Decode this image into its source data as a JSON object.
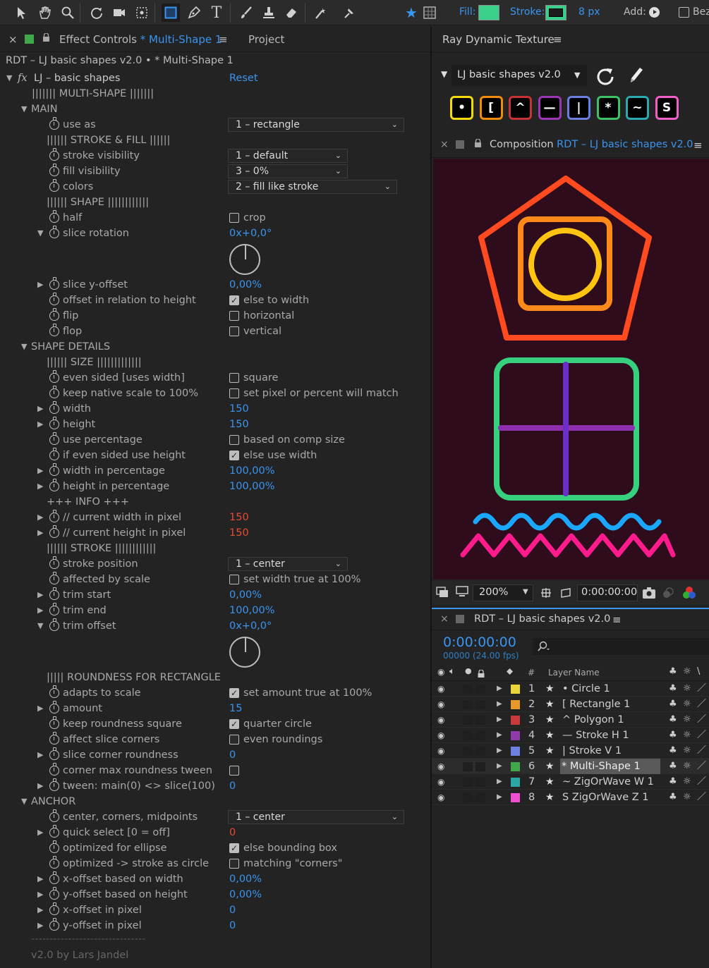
{
  "toolbar": {
    "fill_label": "Fill:",
    "fill_color": "#3ad08c",
    "stroke_label": "Stroke:",
    "stroke_color": "#3ad08c",
    "stroke_width": "8 px",
    "add_label": "Add:",
    "bez_label": "Bez"
  },
  "effect_panel": {
    "close": "×",
    "tab_prefix": "Effect Controls",
    "tab_layer": "* Multi-Shape 1",
    "menu": "≡",
    "tab_project": "Project",
    "breadcrumb": "RDT – LJ basic shapes v2.0 • * Multi-Shape 1",
    "fx": "fx",
    "effect_name": "LJ – basic shapes",
    "reset": "Reset",
    "footer_line": "-------------------------------",
    "footer": "v2.0 by Lars Jandel"
  },
  "rows": [
    {
      "ind": 45,
      "txt": "||||||| MULTI-SHAPE |||||||"
    },
    {
      "ind": 30,
      "tw": "▼",
      "txt": "MAIN"
    },
    {
      "ind": 70,
      "sw": 1,
      "txt": "use as",
      "dd": "1 – rectangle",
      "ddw": 250
    },
    {
      "ind": 66,
      "txt": "|||||| STROKE & FILL ||||||"
    },
    {
      "ind": 70,
      "sw": 1,
      "txt": "stroke visibility",
      "dd": "1 – default",
      "ddw": 170
    },
    {
      "ind": 70,
      "sw": 1,
      "txt": "fill visibility",
      "dd": "3 – 0%",
      "ddw": 170
    },
    {
      "ind": 70,
      "sw": 1,
      "txt": "colors",
      "dd": "2 – fill like stroke",
      "ddw": 240
    },
    {
      "ind": 66,
      "txt": "|||||| SHAPE ||||||||||||"
    },
    {
      "ind": 70,
      "sw": 1,
      "txt": "half",
      "cb": 0,
      "cbl": "crop"
    },
    {
      "ind": 70,
      "sw": 1,
      "tw": "▼",
      "txt": "slice rotation",
      "num": "0x+0,0°",
      "dial": 1
    },
    {
      "ind": 70,
      "sw": 1,
      "tw": "▶",
      "txt": "slice y-offset",
      "num": "0,00%"
    },
    {
      "ind": 70,
      "sw": 1,
      "txt": "offset in relation to height",
      "cb": 1,
      "cbl": "else to width"
    },
    {
      "ind": 70,
      "sw": 1,
      "txt": "flip",
      "cb": 0,
      "cbl": "horizontal"
    },
    {
      "ind": 70,
      "sw": 1,
      "txt": "flop",
      "cb": 0,
      "cbl": "vertical"
    },
    {
      "ind": 30,
      "tw": "▼",
      "txt": "SHAPE DETAILS"
    },
    {
      "ind": 66,
      "txt": "|||||| SIZE |||||||||||||"
    },
    {
      "ind": 70,
      "sw": 1,
      "txt": "even sided [uses width]",
      "cb": 0,
      "cbl": "square"
    },
    {
      "ind": 70,
      "sw": 1,
      "txt": "keep native scale to 100%",
      "cb": 0,
      "cbl": "set pixel or percent will match"
    },
    {
      "ind": 70,
      "sw": 1,
      "tw": "▶",
      "txt": "width",
      "num": "150"
    },
    {
      "ind": 70,
      "sw": 1,
      "tw": "▶",
      "txt": "height",
      "num": "150"
    },
    {
      "ind": 70,
      "sw": 1,
      "txt": "use percentage",
      "cb": 0,
      "cbl": "based on comp size"
    },
    {
      "ind": 70,
      "sw": 1,
      "txt": "if even sided use height",
      "cb": 1,
      "cbl": "else use width"
    },
    {
      "ind": 70,
      "sw": 1,
      "tw": "▶",
      "txt": "width in percentage",
      "num": "100,00%"
    },
    {
      "ind": 70,
      "sw": 1,
      "tw": "▶",
      "txt": "height in percentage",
      "num": "100,00%"
    },
    {
      "ind": 66,
      "txt": "+++ INFO +++"
    },
    {
      "ind": 70,
      "sw": 1,
      "tw": "▶",
      "txt": "// current width in pixel",
      "red": "150"
    },
    {
      "ind": 70,
      "sw": 1,
      "tw": "▶",
      "txt": "// current height in pixel",
      "red": "150"
    },
    {
      "ind": 66,
      "txt": "|||||| STROKE ||||||||||||"
    },
    {
      "ind": 70,
      "sw": 1,
      "txt": "stroke position",
      "dd": "1 – center",
      "ddw": 170
    },
    {
      "ind": 70,
      "sw": 1,
      "txt": "affected by scale",
      "cb": 0,
      "cbl": "set width true at 100%"
    },
    {
      "ind": 70,
      "sw": 1,
      "tw": "▶",
      "txt": "trim start",
      "num": "0,00%"
    },
    {
      "ind": 70,
      "sw": 1,
      "tw": "▶",
      "txt": "trim end",
      "num": "100,00%"
    },
    {
      "ind": 70,
      "sw": 1,
      "tw": "▼",
      "txt": "trim offset",
      "num": "0x+0,0°",
      "dial": 1
    },
    {
      "ind": 66,
      "txt": "||||| ROUNDNESS FOR RECTANGLE"
    },
    {
      "ind": 70,
      "sw": 1,
      "txt": "adapts to scale",
      "cb": 1,
      "cbl": "set amount true at 100%"
    },
    {
      "ind": 70,
      "sw": 1,
      "tw": "▶",
      "txt": "amount",
      "num": "15"
    },
    {
      "ind": 70,
      "sw": 1,
      "txt": "keep roundness square",
      "cb": 1,
      "cbl": "quarter circle"
    },
    {
      "ind": 70,
      "sw": 1,
      "txt": "affect slice corners",
      "cb": 0,
      "cbl": "even roundings"
    },
    {
      "ind": 70,
      "sw": 1,
      "tw": "▶",
      "txt": "slice corner roundness",
      "num": "0"
    },
    {
      "ind": 70,
      "sw": 1,
      "txt": "corner max roundness tween",
      "cb": 0,
      "cbl": ""
    },
    {
      "ind": 70,
      "sw": 1,
      "tw": "▶",
      "txt": "tween: main(0) <> slice(100)",
      "num": "0"
    },
    {
      "ind": 30,
      "tw": "▼",
      "txt": "ANCHOR"
    },
    {
      "ind": 70,
      "sw": 1,
      "txt": "center, corners, midpoints",
      "dd": "1 – center",
      "ddw": 250
    },
    {
      "ind": 70,
      "sw": 1,
      "tw": "▶",
      "txt": "quick select [0 = off]",
      "red": "0"
    },
    {
      "ind": 70,
      "sw": 1,
      "txt": "optimized for ellipse",
      "cb": 1,
      "cbl": "else bounding box"
    },
    {
      "ind": 70,
      "sw": 1,
      "txt": "optimized -> stroke as circle",
      "cb": 0,
      "cbl": "matching \"corners\""
    },
    {
      "ind": 70,
      "sw": 1,
      "tw": "▶",
      "txt": "x-offset based on width",
      "num": "0,00%"
    },
    {
      "ind": 70,
      "sw": 1,
      "tw": "▶",
      "txt": "y-offset based on height",
      "num": "0,00%"
    },
    {
      "ind": 70,
      "sw": 1,
      "tw": "▶",
      "txt": "x-offset in pixel",
      "num": "0"
    },
    {
      "ind": 70,
      "sw": 1,
      "tw": "▶",
      "txt": "y-offset in pixel",
      "num": "0"
    }
  ],
  "rdt_panel": {
    "title": "Ray Dynamic Texture",
    "menu": "≡",
    "preset": "LJ basic shapes v2.0",
    "buttons": [
      {
        "label": "•",
        "color": "#f5d90a"
      },
      {
        "label": "[",
        "color": "#f08c0a"
      },
      {
        "label": "^",
        "color": "#c83232"
      },
      {
        "label": "—",
        "color": "#9b35b5"
      },
      {
        "label": "|",
        "color": "#6a7ee0"
      },
      {
        "label": "*",
        "color": "#3cc265"
      },
      {
        "label": "~",
        "color": "#2aa9b0"
      },
      {
        "label": "S",
        "color": "#f060c8"
      }
    ]
  },
  "comp_panel": {
    "close": "×",
    "prefix": "Composition",
    "name": "RDT – LJ basic shapes v2.0",
    "menu": "≡",
    "zoom": "200%",
    "timecode": "0:00:00:00"
  },
  "timeline": {
    "close": "×",
    "title": "RDT – LJ basic shapes v2.0",
    "menu": "≡",
    "time": "0:00:00:00",
    "frames": "00000 (24.00 fps)",
    "col_num": "#",
    "col_name": "Layer Name",
    "layers": [
      {
        "n": "1",
        "name": "• Circle 1",
        "color": "#e8d53a"
      },
      {
        "n": "2",
        "name": "[ Rectangle 1",
        "color": "#e8982a"
      },
      {
        "n": "3",
        "name": "^ Polygon 1",
        "color": "#c83a3a"
      },
      {
        "n": "4",
        "name": "— Stroke H 1",
        "color": "#8e3aa8"
      },
      {
        "n": "5",
        "name": "| Stroke V 1",
        "color": "#6d7fe0"
      },
      {
        "n": "6",
        "name": "* Multi-Shape 1",
        "color": "#3fa84a"
      },
      {
        "n": "7",
        "name": "~ ZigOrWave W 1",
        "color": "#2aa7a7"
      },
      {
        "n": "8",
        "name": "S ZigOrWave Z 1",
        "color": "#f050d0"
      }
    ]
  }
}
